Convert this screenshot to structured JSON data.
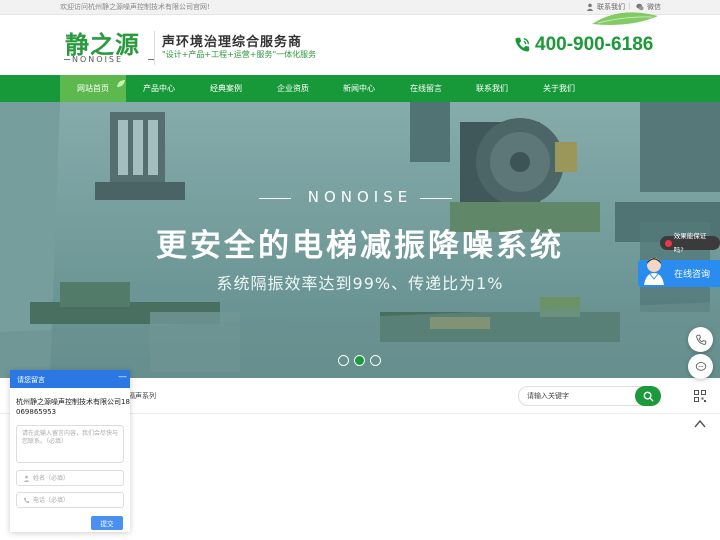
{
  "topbar": {
    "welcome": "欢迎访问杭州静之源噪声控制技术有限公司官网!",
    "contact": "联系我们",
    "separator": "|",
    "wechat": "微信"
  },
  "header": {
    "logo_cn": "静之源",
    "logo_en": "NONOISE",
    "slogan_main": "声环境治理综合服务商",
    "slogan_sub": "\"设计+产品+工程+运营+服务\"一体化服务",
    "phone": "400-900-6186"
  },
  "nav": {
    "items": [
      {
        "label": "网站首页",
        "active": true
      },
      {
        "label": "产品中心",
        "active": false
      },
      {
        "label": "经典案例",
        "active": false
      },
      {
        "label": "企业资质",
        "active": false
      },
      {
        "label": "新闻中心",
        "active": false
      },
      {
        "label": "在线留言",
        "active": false
      },
      {
        "label": "联系我们",
        "active": false
      },
      {
        "label": "关于我们",
        "active": false
      }
    ]
  },
  "banner": {
    "brand": "NONOISE",
    "title": "更安全的电梯减振降噪系统",
    "subtitle": "系统隔振效率达到99%、传递比为1%",
    "slide_count": 3,
    "active_slide": 2
  },
  "breadcrumb": {
    "text": "隔声系列"
  },
  "search": {
    "placeholder": "请输入关键字"
  },
  "float": {
    "tooltip": "效果能保证吗?",
    "consult_label": "在线咨询"
  },
  "message_widget": {
    "title": "请您留言",
    "minimize": "—",
    "company": "杭州静之源噪声控制技术有限公司18069865953",
    "textarea_placeholder": "请在此输入留言内容，我们会尽快与您联系。（必填）",
    "name_placeholder": "姓名（必填）",
    "phone_placeholder": "电话（必填）",
    "submit": "提交"
  },
  "colors": {
    "brand_green": "#17993a",
    "nav_active": "#5db84e",
    "accent_blue": "#2b78e4"
  }
}
